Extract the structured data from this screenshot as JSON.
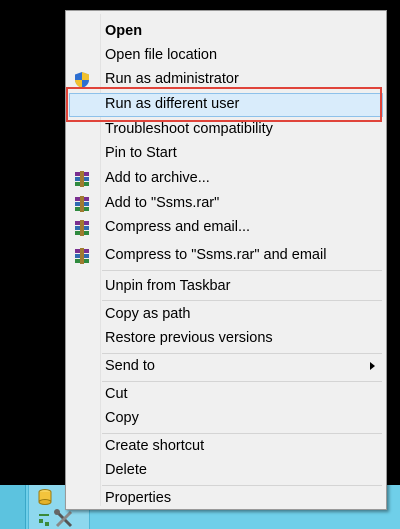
{
  "menu": {
    "items": [
      {
        "label": "Open",
        "bold": true,
        "icon": ""
      },
      {
        "label": "Open file location",
        "icon": ""
      },
      {
        "label": "Run as administrator",
        "icon": "uac-shield-icon"
      },
      {
        "label": "Run as different user",
        "icon": "",
        "highlighted": true
      },
      {
        "label": "Troubleshoot compatibility",
        "icon": ""
      },
      {
        "label": "Pin to Start",
        "icon": ""
      },
      {
        "label": "Add to archive...",
        "icon": "winrar-icon"
      },
      {
        "label": "Add to \"Ssms.rar\"",
        "icon": "winrar-icon"
      },
      {
        "label": "Compress and email...",
        "icon": "winrar-icon"
      },
      {
        "label": "Compress to \"Ssms.rar\" and email",
        "icon": "winrar-icon"
      },
      {
        "label": "Unpin from Taskbar",
        "icon": ""
      },
      {
        "label": "Copy as path",
        "icon": ""
      },
      {
        "label": "Restore previous versions",
        "icon": ""
      },
      {
        "label": "Send to",
        "icon": "",
        "submenu": true
      },
      {
        "label": "Cut",
        "icon": ""
      },
      {
        "label": "Copy",
        "icon": ""
      },
      {
        "label": "Create shortcut",
        "icon": ""
      },
      {
        "label": "Delete",
        "icon": ""
      },
      {
        "label": "Properties",
        "icon": ""
      }
    ]
  },
  "taskbar": {
    "apps": [
      {
        "icon": "database-icon"
      },
      {
        "icon": "tools-icon"
      }
    ]
  },
  "colors": {
    "highlight_bg": "#d9ecfb",
    "highlight_border": "#8ec1ea",
    "annotation_red": "#e0443a",
    "taskbar": "#6fcfe9"
  }
}
